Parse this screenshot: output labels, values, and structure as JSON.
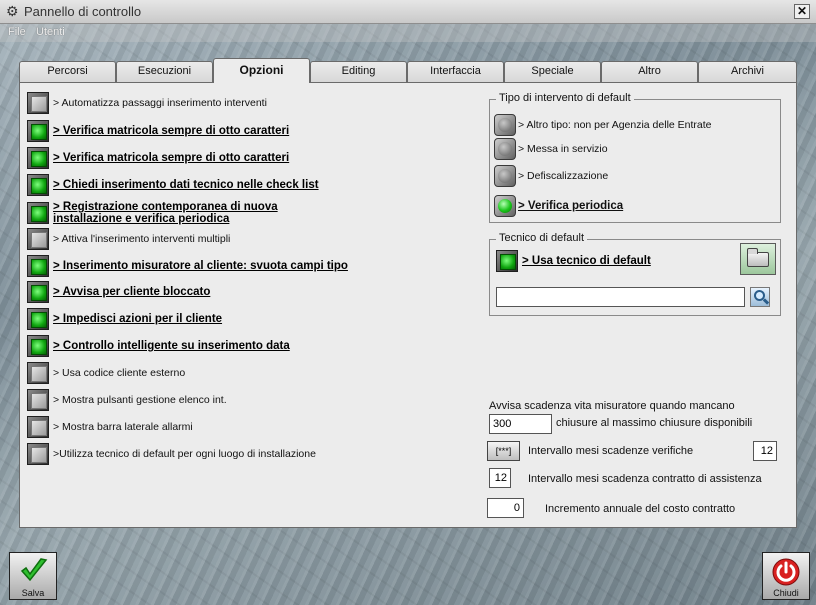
{
  "window": {
    "title": "Pannello di controllo",
    "close_glyph": "✕",
    "app_icon": "gear-icon"
  },
  "menu": [
    "File",
    "Utenti"
  ],
  "tabs": [
    "Percorsi",
    "Esecuzioni",
    "Opzioni",
    "Editing",
    "Interfaccia",
    "Speciale",
    "Altro",
    "Archivi"
  ],
  "active_tab": "Opzioni",
  "options": [
    {
      "label": "> Automatizza passaggi inserimento interventi",
      "checked": false
    },
    {
      "label": "> Verifica matricola sempre di otto caratteri",
      "checked": true
    },
    {
      "label": "> Verifica matricola sempre di otto caratteri",
      "checked": true
    },
    {
      "label": "> Chiedi inserimento dati tecnico nelle check list",
      "checked": true
    },
    {
      "label": "> Registrazione contemporanea di nuova installazione e verifica periodica",
      "checked": true
    },
    {
      "label": "> Attiva l'inserimento interventi multipli",
      "checked": false
    },
    {
      "label": "> Inserimento misuratore al cliente: svuota campi tipo",
      "checked": true
    },
    {
      "label": "> Avvisa per cliente bloccato",
      "checked": true
    },
    {
      "label": "> Impedisci azioni per il cliente",
      "checked": true
    },
    {
      "label": "> Controllo intelligente su inserimento data",
      "checked": true
    },
    {
      "label": "> Usa codice cliente esterno",
      "checked": false
    },
    {
      "label": "> Mostra pulsanti gestione elenco int.",
      "checked": false
    },
    {
      "label": "> Mostra barra laterale allarmi",
      "checked": false
    },
    {
      "label": ">Utilizza tecnico di default per ogni luogo di installazione",
      "checked": false
    }
  ],
  "tipo_intervento": {
    "title": "Tipo di intervento di default",
    "options": [
      {
        "label": "> Altro tipo: non per Agenzia delle Entrate",
        "selected": false
      },
      {
        "label": "> Messa in servizio",
        "selected": false
      },
      {
        "label": "> Defiscalizzazione",
        "selected": false
      },
      {
        "label": "> Verifica periodica",
        "selected": true
      }
    ]
  },
  "tecnico": {
    "title": "Tecnico di default",
    "checkbox_label": "> Usa tecnico di default",
    "checked": true,
    "input_value": "",
    "folder_icon": "folder-icon",
    "search_icon": "search-icon"
  },
  "scadenze": {
    "avvisa_label": "Avvisa scadenza vita misuratore quando mancano",
    "chiusure_value": "300",
    "chiusure_label": "chiusure al massimo chiusure disponibili",
    "verifiche_button": "[***]",
    "verifiche_label": "Intervallo mesi scadenze verifiche",
    "verifiche_value": "12",
    "contratto_value": "12",
    "contratto_label": "Intervallo mesi scadenza contratto di assistenza",
    "incremento_value": "0",
    "incremento_label": "Incremento annuale del costo contratto"
  },
  "footer": {
    "save_label": "Salva",
    "close_label": "Chiudi",
    "save_icon": "checkmark-icon",
    "close_icon": "power-icon"
  }
}
